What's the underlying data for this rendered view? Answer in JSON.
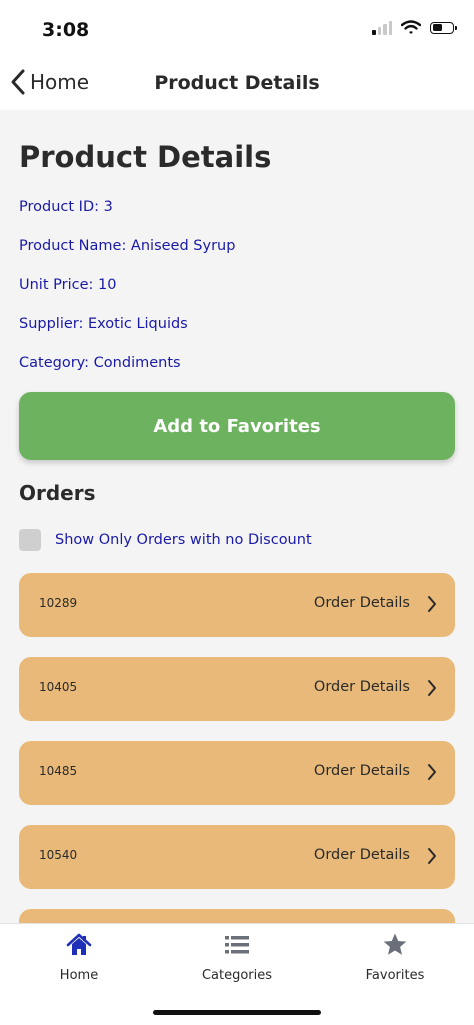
{
  "status_bar": {
    "time": "3:08"
  },
  "nav": {
    "back_label": "Home",
    "title": "Product Details"
  },
  "product": {
    "heading": "Product Details",
    "id_line": "Product ID: 3",
    "name_line": "Product Name: Aniseed Syrup",
    "price_line": "Unit Price: 10",
    "supplier_line": "Supplier: Exotic Liquids",
    "category_line": "Category: Condiments"
  },
  "actions": {
    "favorite_label": "Add to Favorites"
  },
  "orders": {
    "heading": "Orders",
    "filter_label": "Show Only Orders with no Discount",
    "filter_checked": false,
    "link_label": "Order Details",
    "items": [
      {
        "id": "10289"
      },
      {
        "id": "10405"
      },
      {
        "id": "10485"
      },
      {
        "id": "10540"
      }
    ]
  },
  "tabs": [
    {
      "label": "Home",
      "icon": "home-icon",
      "active": true
    },
    {
      "label": "Categories",
      "icon": "list-icon",
      "active": false
    },
    {
      "label": "Favorites",
      "icon": "star-icon",
      "active": false
    }
  ],
  "colors": {
    "accent_button": "#6db25e",
    "order_card": "#e8b978",
    "link_text": "#1a1aa6",
    "active_tab": "#1f2fb8",
    "inactive_tab": "#6b6f7a"
  }
}
